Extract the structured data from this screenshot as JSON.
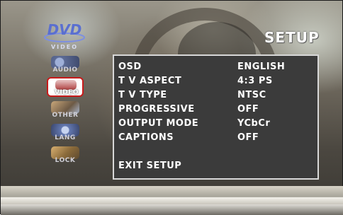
{
  "header": {
    "logo_text": "DVD",
    "logo_subtext": "VIDEO",
    "title": "SETUP"
  },
  "sidebar": {
    "items": [
      {
        "label": "AUDIO",
        "icon": "audio-icon",
        "selected": false
      },
      {
        "label": "VIDEO",
        "icon": "video-icon",
        "selected": true
      },
      {
        "label": "OTHER",
        "icon": "other-icon",
        "selected": false
      },
      {
        "label": "LANG",
        "icon": "lang-icon",
        "selected": false
      },
      {
        "label": "LOCK",
        "icon": "lock-icon",
        "selected": false
      }
    ]
  },
  "menu": {
    "items": [
      {
        "label": "OSD",
        "value": "ENGLISH"
      },
      {
        "label": "T V ASPECT",
        "value": "4:3 PS"
      },
      {
        "label": "T V TYPE",
        "value": "NTSC"
      },
      {
        "label": "PROGRESSIVE",
        "value": "OFF"
      },
      {
        "label": "OUTPUT MODE",
        "value": "YCbCr"
      },
      {
        "label": "CAPTIONS",
        "value": "OFF"
      }
    ],
    "exit_label": "EXIT SETUP"
  },
  "colors": {
    "panel_bg": "#3b3b3b",
    "panel_border": "#d8d8d8",
    "text": "#ffffff",
    "selected_border": "#c81a1a",
    "logo_blue": "#5a6fd0"
  }
}
